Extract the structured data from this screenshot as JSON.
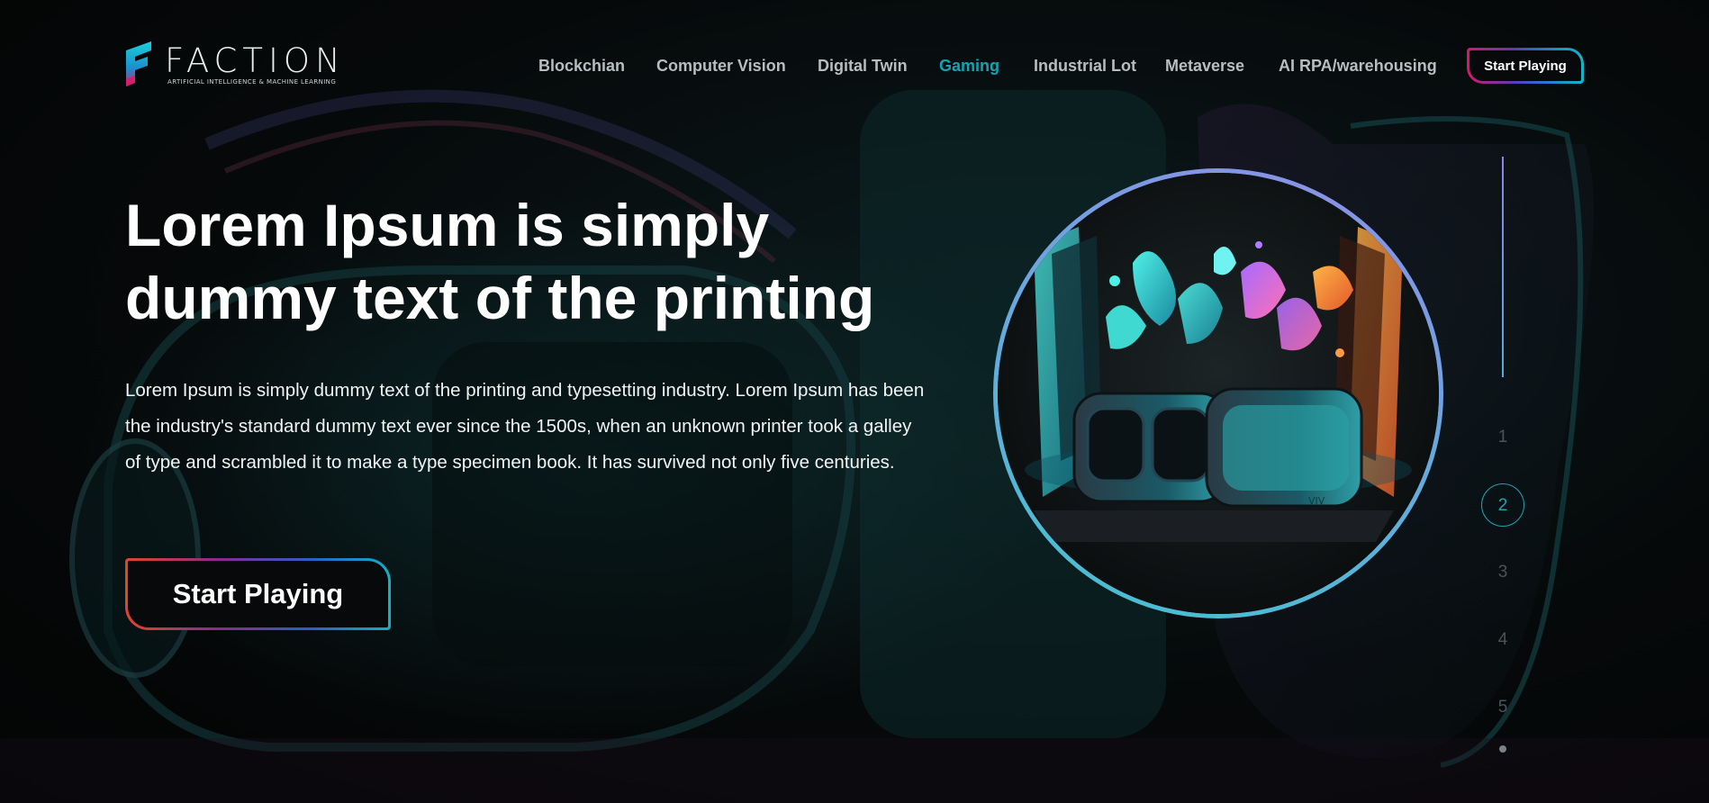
{
  "brand": {
    "name": "FACTION",
    "tagline": "ARTIFICIAL INTELLIGENCE & MACHINE LEARNING"
  },
  "nav": {
    "items": [
      {
        "label": "Blockchian",
        "active": false
      },
      {
        "label": "Computer Vision",
        "active": false
      },
      {
        "label": "Digital Twin",
        "active": false
      },
      {
        "label": "Gaming",
        "active": true
      },
      {
        "label": "Industrial Lot",
        "active": false
      },
      {
        "label": "Metaverse",
        "active": false
      },
      {
        "label": "AI RPA/warehousing",
        "active": false
      }
    ],
    "cta_label": "Start Playing"
  },
  "hero": {
    "title_line1": "Lorem Ipsum is simply",
    "title_line2": "dummy text of the printing",
    "body": "Lorem Ipsum is simply dummy text of the printing and typesetting industry. Lorem Ipsum has been the industry's standard dummy text ever since the 1500s, when an unknown printer took a galley of type and scrambled it to make a type specimen book. It has survived not only five centuries.",
    "cta_label": "Start Playing",
    "image_icon": "vr-headset-image",
    "headset_brand": "VIV"
  },
  "pager": {
    "pages": [
      "1",
      "2",
      "3",
      "4",
      "5"
    ],
    "current": "2"
  },
  "colors": {
    "accent": "#13a4b4",
    "background": "#050708",
    "gradient_pink": "#d4196c",
    "gradient_cyan": "#13b6c8",
    "orb_ring_top": "#8f8de6",
    "orb_ring_bottom": "#44c2cf"
  }
}
